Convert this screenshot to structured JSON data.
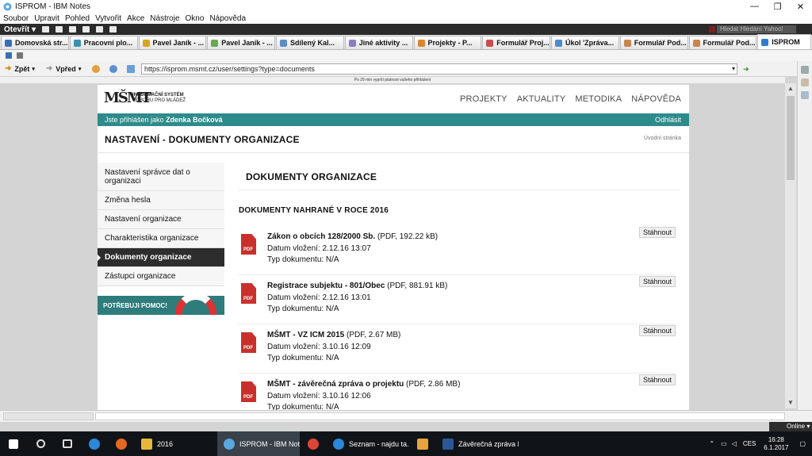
{
  "window": {
    "title": "ISPROM - IBM Notes",
    "controls": [
      "—",
      "❐",
      "✕"
    ]
  },
  "menu": [
    "Soubor",
    "Upravit",
    "Pohled",
    "Vytvořit",
    "Akce",
    "Nástroje",
    "Okno",
    "Nápověda"
  ],
  "notes_toolbar": {
    "open_label": "Otevřít ▾",
    "search_placeholder": "Hledat Hledání Yahoo!"
  },
  "tabs": [
    {
      "label": "Domovská str...",
      "color": "#3a6fb5"
    },
    {
      "label": "Pracovní plo...",
      "color": "#3a8fb5"
    },
    {
      "label": "Pavel Janík - ...",
      "color": "#d9a520"
    },
    {
      "label": "Pavel Janík - ...",
      "color": "#6aa84f"
    },
    {
      "label": "Sdílený Kal...",
      "color": "#5b8cc9"
    },
    {
      "label": "Jiné aktivity ...",
      "color": "#8e7cc3"
    },
    {
      "label": "Projekty - P...",
      "color": "#d9852f"
    },
    {
      "label": "Formulář Proj...",
      "color": "#c94d4d"
    },
    {
      "label": "Úkol 'Zpráva...",
      "color": "#4d8bc9"
    },
    {
      "label": "Formulář Pod...",
      "color": "#c9854d"
    },
    {
      "label": "Formulář Pod...",
      "color": "#c9854d"
    },
    {
      "label": "ISPROM",
      "color": "#2e7cc9",
      "active": true
    }
  ],
  "nav": {
    "back_label": "Zpět",
    "forward_label": "Vpřed",
    "url": "https://isprom.msmt.cz/user/settings?type=documents"
  },
  "session_notice": "Po 29 min vyprší platnost vašeho přihlášení",
  "site": {
    "logo_mark": "MŠMT",
    "logo_line1": "INFORMAČNÍ SYSTÉM",
    "logo_line2": "ODBORU PRO MLÁDEŽ",
    "nav_items": [
      "PROJEKTY",
      "AKTUALITY",
      "METODIKA",
      "NÁPOVĚDA"
    ],
    "user_prefix": "Jste přihlášen jako",
    "user_name": "Zdenka Bočková",
    "logout": "Odhlásit",
    "page_title": "NASTAVENÍ - DOKUMENTY ORGANIZACE",
    "home_link": "Úvodní stránka"
  },
  "sidebar": {
    "items": [
      {
        "label": "Nastavení správce dat o organizaci",
        "active": false
      },
      {
        "label": "Změna hesla",
        "active": false
      },
      {
        "label": "Nastavení organizace",
        "active": false
      },
      {
        "label": "Charakteristika organizace",
        "active": false
      },
      {
        "label": "Dokumenty organizace",
        "active": true
      },
      {
        "label": "Zástupci organizace",
        "active": false
      }
    ],
    "help_label": "POTŘEBUJI POMOC!"
  },
  "content": {
    "heading": "DOKUMENTY ORGANIZACE",
    "subheading": "DOKUMENTY NAHRANÉ V ROCE 2016",
    "download_label": "Stáhnout",
    "pdf_badge": "PDF",
    "documents": [
      {
        "title": "Zákon o obcích 128/2000 Sb.",
        "meta": " (PDF, 192.22 kB)",
        "date": "Datum vložení: 2.12.16 13:07",
        "type": "Typ dokumentu: N/A"
      },
      {
        "title": "Registrace subjektu - 801/Obec",
        "meta": " (PDF, 881.91 kB)",
        "date": "Datum vložení: 2.12.16 13:01",
        "type": "Typ dokumentu: N/A"
      },
      {
        "title": "MŠMT - VZ ICM 2015",
        "meta": " (PDF, 2.67 MB)",
        "date": "Datum vložení: 3.10.16 12:09",
        "type": "Typ dokumentu: N/A"
      },
      {
        "title": "MŠMT - závěrečná zpráva o projektu",
        "meta": " (PDF, 2.86 MB)",
        "date": "Datum vložení: 3.10.16 12:06",
        "type": "Typ dokumentu: N/A"
      }
    ]
  },
  "status": {
    "online": "Online ▾"
  },
  "taskbar": {
    "apps": [
      {
        "label": "",
        "color": "#ffffff",
        "name": "windows-start-icon"
      },
      {
        "label": "",
        "color": "#cccccc",
        "name": "search-icon"
      },
      {
        "label": "",
        "color": "#cccccc",
        "name": "task-view-icon"
      },
      {
        "label": "",
        "color": "#2b87d8",
        "name": "edge-icon"
      },
      {
        "label": "",
        "color": "#e5681f",
        "name": "firefox-icon"
      },
      {
        "label": "2016",
        "color": "#e8b73a",
        "name": "folder-icon"
      },
      {
        "label": "ISPROM - IBM Notes",
        "color": "#5aa7e0",
        "name": "notes-icon",
        "active": true
      },
      {
        "label": "",
        "color": "#db4437",
        "name": "chrome-icon"
      },
      {
        "label": "Seznam - najdu ta...",
        "color": "#2b87d8",
        "name": "ie-icon"
      },
      {
        "label": "",
        "color": "#e8a33a",
        "name": "media-icon"
      },
      {
        "label": "Závěrečná zpráva I...",
        "color": "#2b5797",
        "name": "word-icon"
      }
    ],
    "lang": "CES",
    "time": "16:28",
    "date": "6.1.2017"
  }
}
